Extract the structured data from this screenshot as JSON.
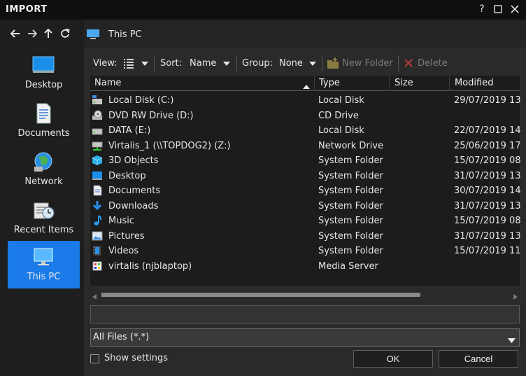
{
  "window": {
    "title": "IMPORT",
    "help_label": "?",
    "maximize_icon": "maximize-icon",
    "close_icon": "close-icon"
  },
  "nav": {
    "back_icon": "arrow-left-icon",
    "forward_icon": "arrow-right-icon",
    "up_icon": "arrow-up-icon",
    "refresh_icon": "refresh-icon"
  },
  "sidebar": {
    "items": [
      {
        "label": "Desktop",
        "icon": "desktop-icon",
        "active": false
      },
      {
        "label": "Documents",
        "icon": "documents-icon",
        "active": false
      },
      {
        "label": "Network",
        "icon": "network-globe-icon",
        "active": false
      },
      {
        "label": "Recent Items",
        "icon": "recent-items-icon",
        "active": false
      },
      {
        "label": "This PC",
        "icon": "this-pc-icon",
        "active": true
      }
    ],
    "active_color": "#1a7be8"
  },
  "path": {
    "text": "This PC",
    "icon": "monitor-icon"
  },
  "toolbar": {
    "view_label": "View:",
    "view_icon": "list-view-icon",
    "sort_label": "Sort:",
    "sort_value": "Name",
    "group_label": "Group:",
    "group_value": "None",
    "new_folder_label": "New Folder",
    "new_folder_icon": "new-folder-icon",
    "delete_label": "Delete",
    "delete_icon": "delete-x-icon"
  },
  "columns": {
    "name": "Name",
    "type": "Type",
    "size": "Size",
    "modified": "Modified",
    "sort_icon": "sort-ascending-icon"
  },
  "files": [
    {
      "name": "Local Disk (C:)",
      "type": "Local Disk",
      "size": "",
      "modified": "29/07/2019 13",
      "icon": "drive-c-icon"
    },
    {
      "name": "DVD RW Drive (D:)",
      "type": "CD Drive",
      "size": "",
      "modified": "",
      "icon": "dvd-drive-icon"
    },
    {
      "name": "DATA (E:)",
      "type": "Local Disk",
      "size": "",
      "modified": "22/07/2019 14",
      "icon": "drive-icon"
    },
    {
      "name": "Virtalis_1 (\\\\TOPDOG2) (Z:)",
      "type": "Network Drive",
      "size": "",
      "modified": "25/06/2019 17",
      "icon": "network-drive-icon"
    },
    {
      "name": "3D Objects",
      "type": "System Folder",
      "size": "",
      "modified": "15/07/2019 08",
      "icon": "3d-objects-icon"
    },
    {
      "name": "Desktop",
      "type": "System Folder",
      "size": "",
      "modified": "31/07/2019 13",
      "icon": "desktop-folder-icon"
    },
    {
      "name": "Documents",
      "type": "System Folder",
      "size": "",
      "modified": "30/07/2019 14",
      "icon": "documents-folder-icon"
    },
    {
      "name": "Downloads",
      "type": "System Folder",
      "size": "",
      "modified": "31/07/2019 13",
      "icon": "downloads-icon"
    },
    {
      "name": "Music",
      "type": "System Folder",
      "size": "",
      "modified": "15/07/2019 08",
      "icon": "music-icon"
    },
    {
      "name": "Pictures",
      "type": "System Folder",
      "size": "",
      "modified": "31/07/2019 13",
      "icon": "pictures-icon"
    },
    {
      "name": "Videos",
      "type": "System Folder",
      "size": "",
      "modified": "15/07/2019 11",
      "icon": "videos-icon"
    },
    {
      "name": "virtalis (njblaptop)",
      "type": "Media Server",
      "size": "",
      "modified": "",
      "icon": "media-server-icon"
    }
  ],
  "filename_value": "",
  "filter": {
    "value": "All Files (*.*)"
  },
  "show_settings_label": "Show settings",
  "ok_label": "OK",
  "cancel_label": "Cancel"
}
